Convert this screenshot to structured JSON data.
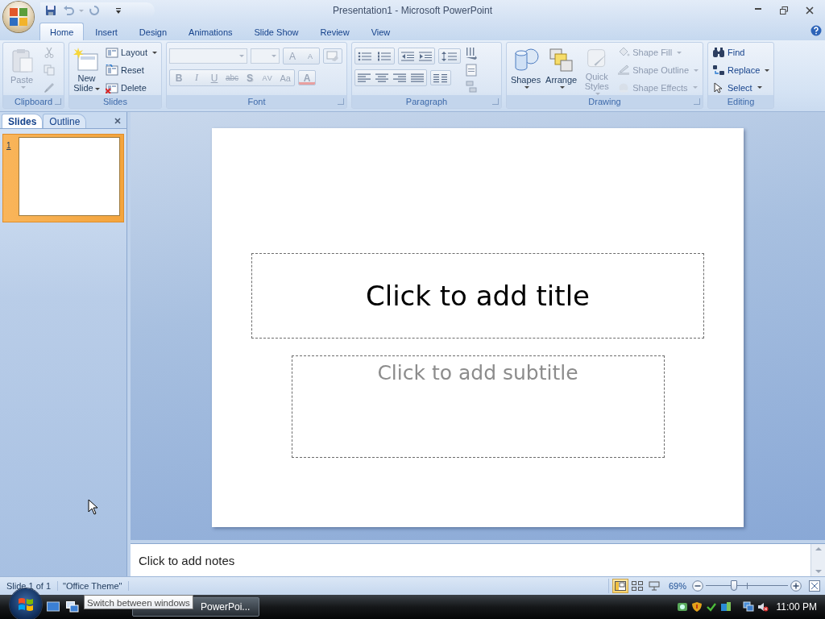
{
  "window": {
    "title": "Presentation1 - Microsoft PowerPoint"
  },
  "tabs": [
    {
      "label": "Home",
      "selected": true
    },
    {
      "label": "Insert",
      "selected": false
    },
    {
      "label": "Design",
      "selected": false
    },
    {
      "label": "Animations",
      "selected": false
    },
    {
      "label": "Slide Show",
      "selected": false
    },
    {
      "label": "Review",
      "selected": false
    },
    {
      "label": "View",
      "selected": false
    }
  ],
  "ribbon": {
    "clipboard": {
      "label": "Clipboard",
      "paste": {
        "label": "Paste",
        "disabled": true
      },
      "cut": {
        "disabled": true
      },
      "copy": {
        "disabled": true
      },
      "format_painter": {
        "disabled": true
      }
    },
    "slides": {
      "label": "Slides",
      "new_slide": {
        "label": "New Slide"
      },
      "small": [
        {
          "label": "Layout",
          "dropdown": true
        },
        {
          "label": "Reset",
          "dropdown": false
        },
        {
          "label": "Delete",
          "dropdown": false
        }
      ]
    },
    "font": {
      "label": "Font",
      "disabled": true,
      "size_buttons": [
        {
          "label": "A"
        },
        {
          "label": "A"
        }
      ],
      "format_buttons": [
        {
          "label": "B"
        },
        {
          "label": "I"
        },
        {
          "label": "U"
        },
        {
          "label": "abc"
        },
        {
          "label": "S"
        },
        {
          "label": "AV"
        },
        {
          "label": "Aa"
        }
      ],
      "font_color": {
        "label": "A"
      }
    },
    "paragraph": {
      "label": "Paragraph"
    },
    "drawing": {
      "label": "Drawing",
      "large": [
        {
          "label": "Shapes",
          "disabled": false
        },
        {
          "label": "Arrange",
          "disabled": false
        },
        {
          "label": "Quick Styles",
          "disabled": true
        }
      ],
      "small": [
        {
          "label": "Shape Fill",
          "disabled": true
        },
        {
          "label": "Shape Outline",
          "disabled": true
        },
        {
          "label": "Shape Effects",
          "disabled": true
        }
      ]
    },
    "editing": {
      "label": "Editing",
      "buttons": [
        {
          "label": "Find",
          "dropdown": false
        },
        {
          "label": "Replace",
          "dropdown": true
        },
        {
          "label": "Select",
          "dropdown": true
        }
      ]
    }
  },
  "slides_pane": {
    "tabs": [
      {
        "label": "Slides",
        "selected": true
      },
      {
        "label": "Outline",
        "selected": false
      }
    ],
    "thumbnails": [
      {
        "number": "1",
        "selected": true
      }
    ]
  },
  "slide": {
    "title_placeholder": "Click to add title",
    "subtitle_placeholder": "Click to add subtitle"
  },
  "notes": {
    "placeholder": "Click to add notes"
  },
  "status_bar": {
    "slide_count": "Slide 1 of 1",
    "theme": "\"Office Theme\"",
    "views": [
      {
        "selected": true
      },
      {
        "selected": false
      },
      {
        "selected": false
      }
    ],
    "zoom": "69%",
    "zoom_slider": {
      "level": 0.34
    }
  },
  "taskbar": {
    "task": {
      "label": "PowerPoi...",
      "selected": true
    },
    "tooltip": "Switch between windows",
    "clock": "11:00 PM"
  }
}
